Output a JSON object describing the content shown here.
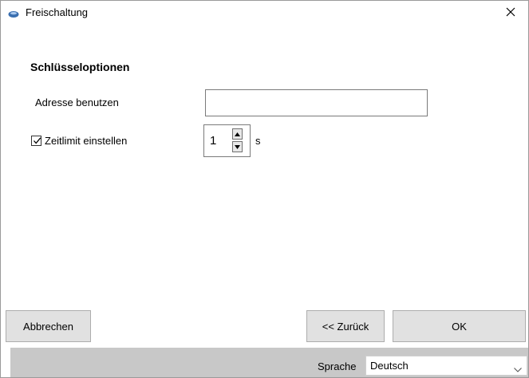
{
  "window": {
    "title": "Freischaltung",
    "app_icon": "eye-icon",
    "close_icon": "close-icon"
  },
  "section": {
    "title": "Schlüsseloptionen"
  },
  "address": {
    "label": "Adresse benutzen",
    "value": ""
  },
  "timelimit": {
    "label": "Zeitlimit einstellen",
    "checked": true,
    "value": "1",
    "unit": "s"
  },
  "buttons": {
    "cancel": "Abbrechen",
    "back": "<< Zurück",
    "ok": "OK"
  },
  "language": {
    "label": "Sprache",
    "value": "Deutsch"
  },
  "colors": {
    "accent": "#3a6fb0",
    "statusbar": "#c8c8c8",
    "button": "#e1e1e1"
  }
}
